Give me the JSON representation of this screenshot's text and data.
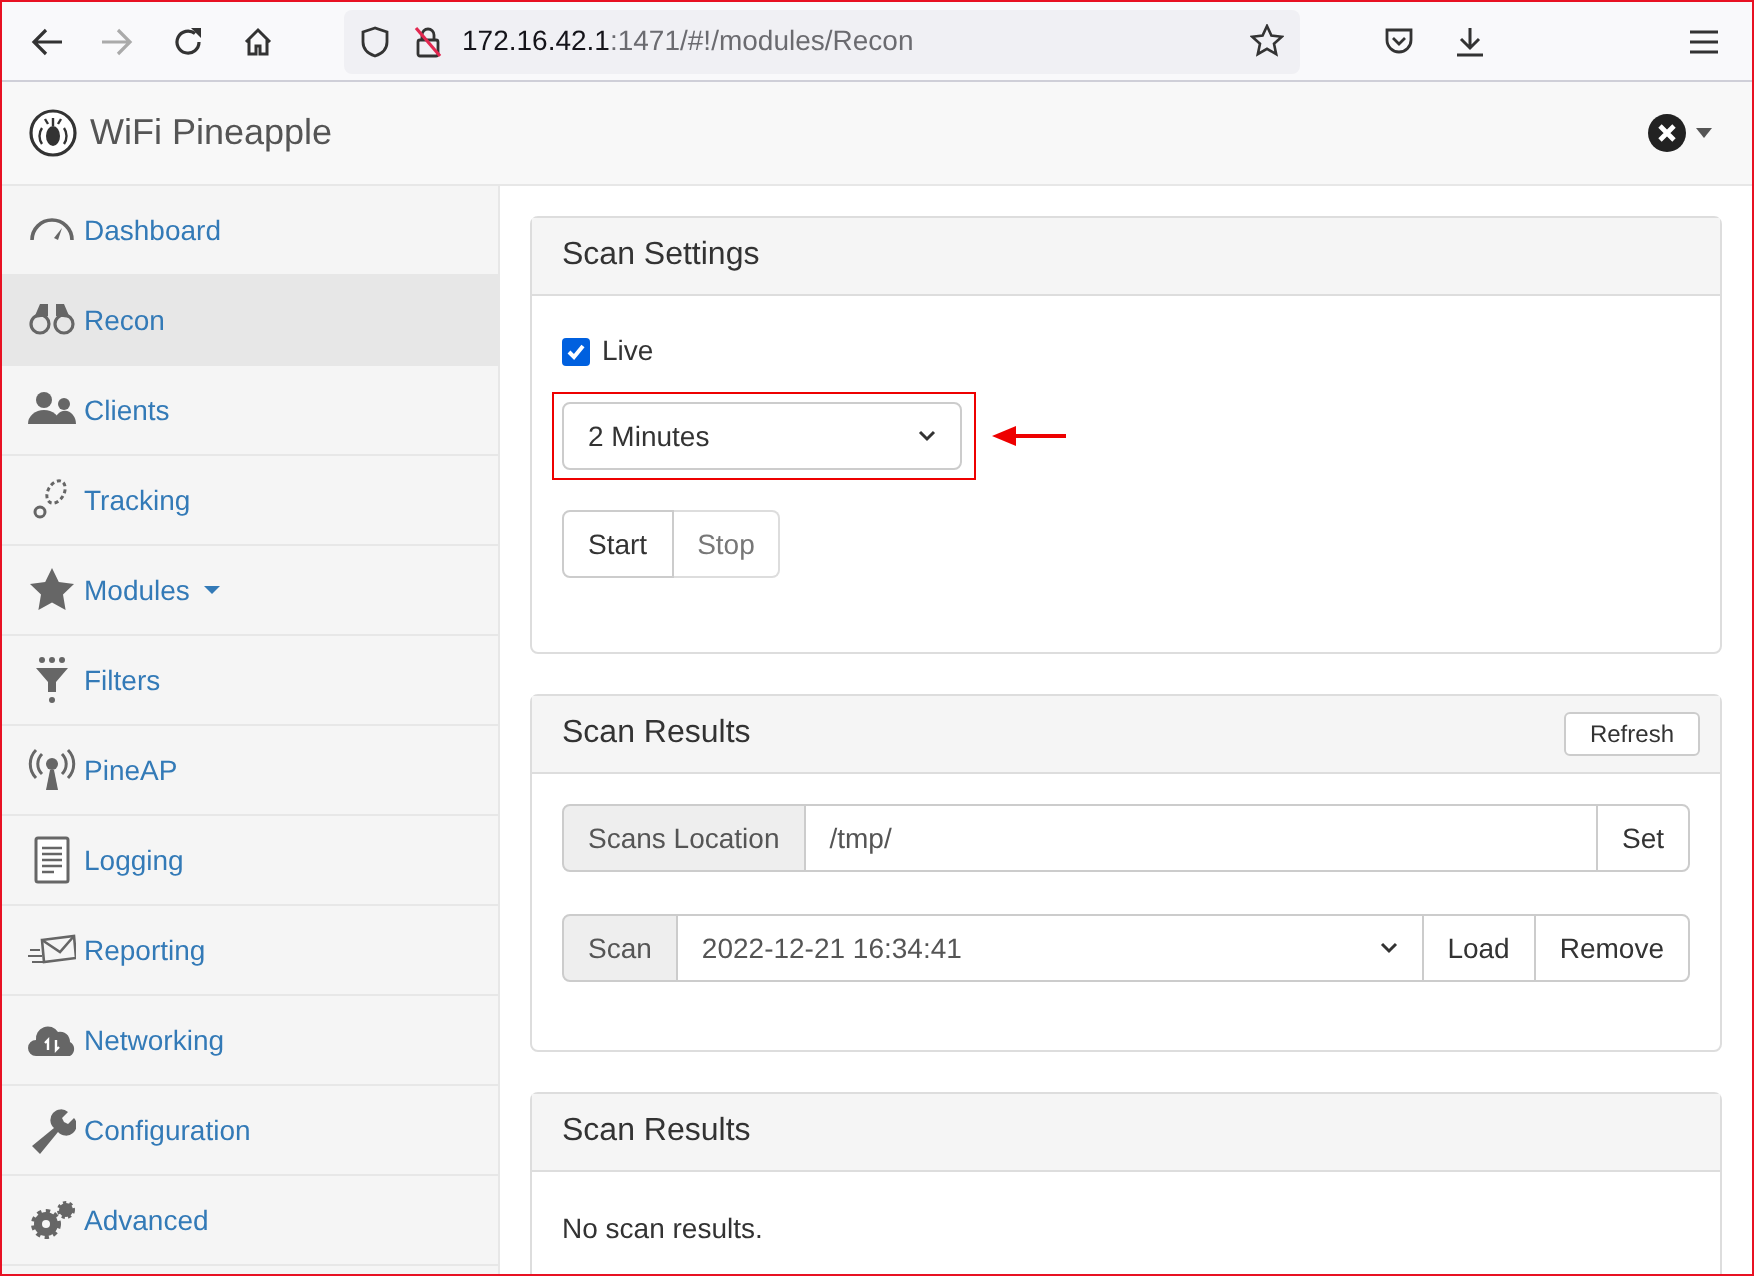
{
  "browser": {
    "url_host": "172.16.42.1",
    "url_rest": ":1471/#!/modules/Recon"
  },
  "app": {
    "title": "WiFi Pineapple"
  },
  "sidebar": {
    "items": [
      {
        "label": "Dashboard",
        "selected": false,
        "has_menu": false
      },
      {
        "label": "Recon",
        "selected": true,
        "has_menu": false
      },
      {
        "label": "Clients",
        "selected": false,
        "has_menu": false
      },
      {
        "label": "Tracking",
        "selected": false,
        "has_menu": false
      },
      {
        "label": "Modules",
        "selected": false,
        "has_menu": true
      },
      {
        "label": "Filters",
        "selected": false,
        "has_menu": false
      },
      {
        "label": "PineAP",
        "selected": false,
        "has_menu": false
      },
      {
        "label": "Logging",
        "selected": false,
        "has_menu": false
      },
      {
        "label": "Reporting",
        "selected": false,
        "has_menu": false
      },
      {
        "label": "Networking",
        "selected": false,
        "has_menu": false
      },
      {
        "label": "Configuration",
        "selected": false,
        "has_menu": false
      },
      {
        "label": "Advanced",
        "selected": false,
        "has_menu": false
      }
    ]
  },
  "scan_settings": {
    "title": "Scan Settings",
    "live": {
      "label": "Live",
      "checked": true
    },
    "duration": {
      "value": "2 Minutes",
      "highlighted": true
    },
    "buttons": [
      {
        "label": "Start",
        "disabled": false
      },
      {
        "label": "Stop",
        "disabled": true
      }
    ]
  },
  "scan_results": {
    "title": "Scan Results",
    "refresh": "Refresh",
    "location": {
      "label": "Scans Location",
      "value": "/tmp/",
      "button": "Set"
    },
    "scan": {
      "label": "Scan",
      "value": "2022-12-21 16:34:41",
      "buttons": [
        "Load",
        "Remove"
      ]
    }
  },
  "results_panel": {
    "title": "Scan Results",
    "message": "No scan results."
  }
}
